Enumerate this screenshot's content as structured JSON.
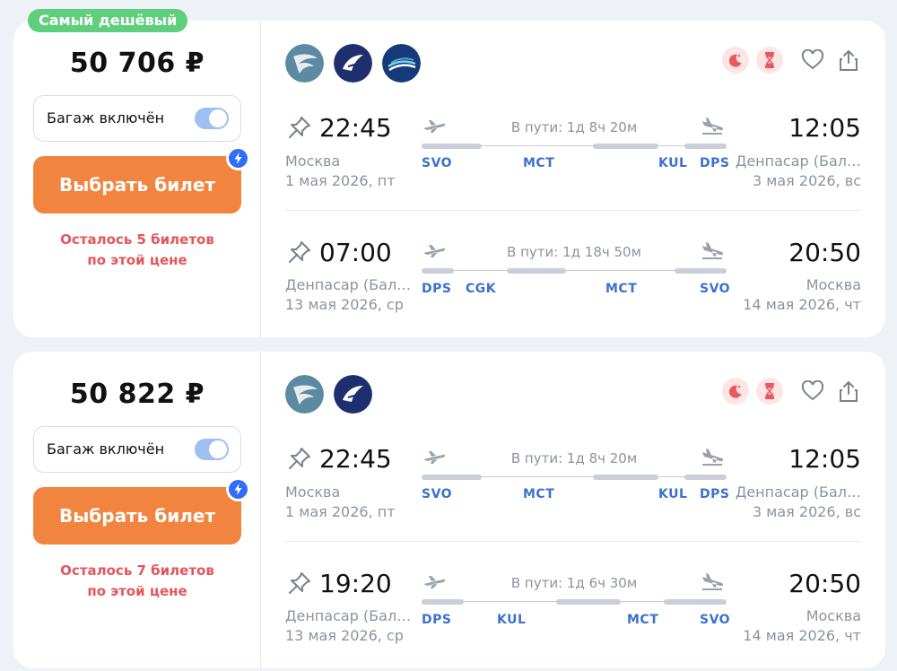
{
  "offers": [
    {
      "badge": "Самый дешёвый",
      "price": "50 706 ₽",
      "baggage_label": "Багаж включён",
      "buy_label": "Выбрать билет",
      "remain_line1": "Осталось 5 билетов",
      "remain_line2": "по этой цене",
      "airline_logos": [
        "airline-logo-wing",
        "airline-logo-malaysia",
        "airline-logo-garuda"
      ],
      "segments": [
        {
          "dep_time": "22:45",
          "dep_city": "Москва",
          "dep_date": "1 мая 2026, пт",
          "arr_time": "12:05",
          "arr_city": "Денпасар (Бал…",
          "arr_date": "3 мая 2026, вс",
          "duration": "В пути: 1д 8ч 20м",
          "codes": [
            "SVO",
            "MCT",
            "KUL",
            "DPS"
          ]
        },
        {
          "dep_time": "07:00",
          "dep_city": "Денпасар (Бал…",
          "dep_date": "13 мая 2026, ср",
          "arr_time": "20:50",
          "arr_city": "Москва",
          "arr_date": "14 мая 2026, чт",
          "duration": "В пути: 1д 18ч 50м",
          "codes": [
            "DPS",
            "CGK",
            "MCT",
            "SVO"
          ]
        }
      ]
    },
    {
      "price": "50 822 ₽",
      "baggage_label": "Багаж включён",
      "buy_label": "Выбрать билет",
      "remain_line1": "Осталось 7 билетов",
      "remain_line2": "по этой цене",
      "airline_logos": [
        "airline-logo-wing",
        "airline-logo-malaysia"
      ],
      "segments": [
        {
          "dep_time": "22:45",
          "dep_city": "Москва",
          "dep_date": "1 мая 2026, пт",
          "arr_time": "12:05",
          "arr_city": "Денпасар (Бал…",
          "arr_date": "3 мая 2026, вс",
          "duration": "В пути: 1д 8ч 20м",
          "codes": [
            "SVO",
            "MCT",
            "KUL",
            "DPS"
          ]
        },
        {
          "dep_time": "19:20",
          "dep_city": "Денпасар (Бал…",
          "dep_date": "13 мая 2026, ср",
          "arr_time": "20:50",
          "arr_city": "Москва",
          "arr_date": "14 мая 2026, чт",
          "duration": "В пути: 1д 6ч 30м",
          "codes": [
            "DPS",
            "KUL",
            "MCT",
            "SVO"
          ]
        }
      ]
    }
  ],
  "colors": {
    "accent_orange": "#f1843e",
    "badge_green": "#5fcf7d",
    "code_blue": "#3a72cf",
    "warning_red": "#e5555b"
  }
}
